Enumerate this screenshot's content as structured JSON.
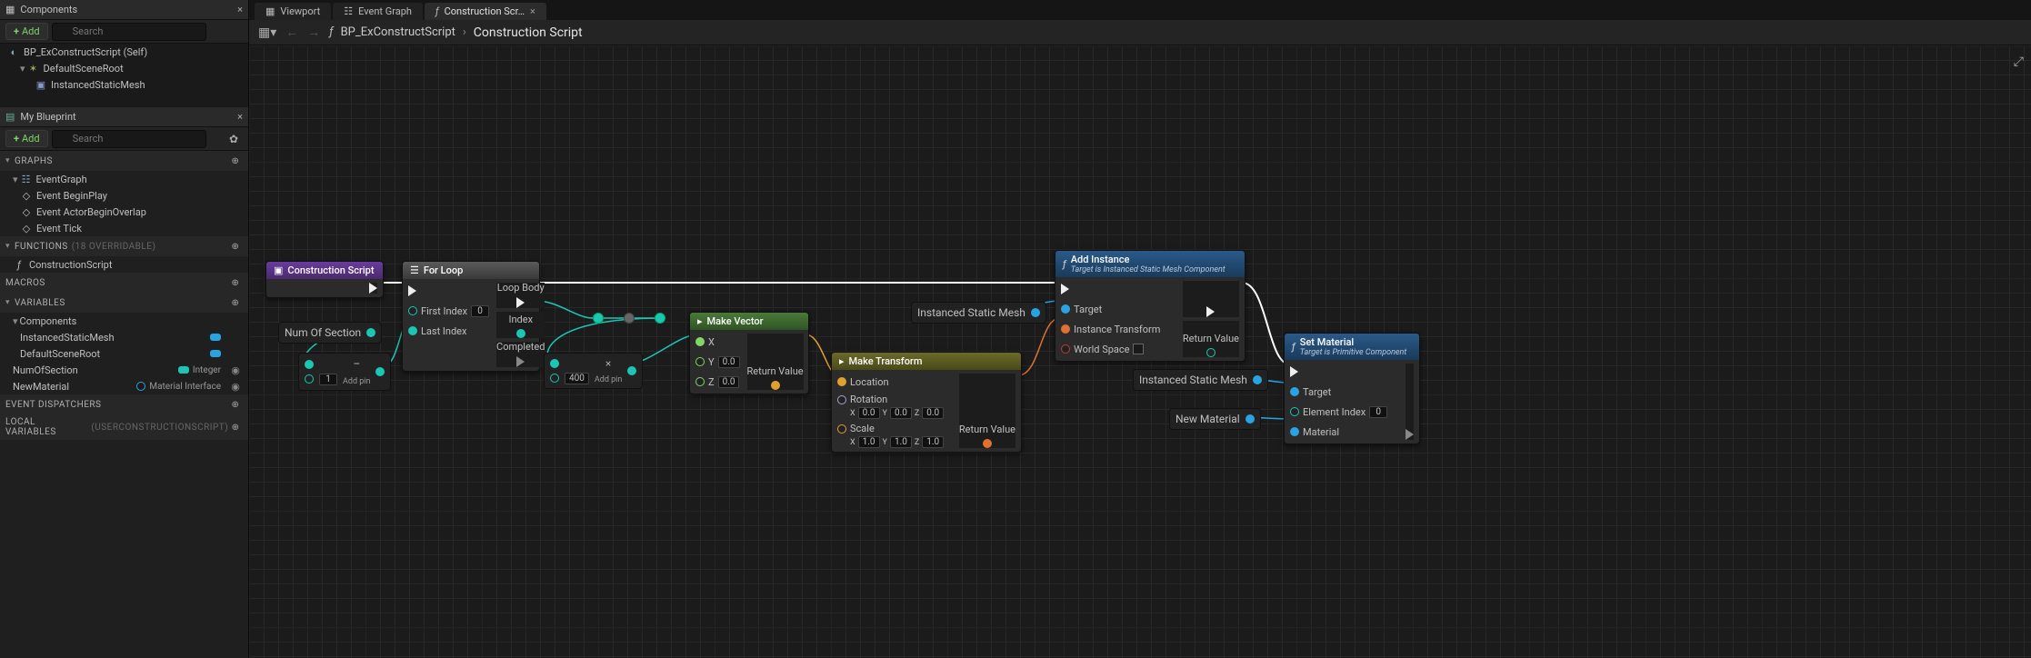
{
  "leftTabs": {
    "components": "Components",
    "myblueprint": "My Blueprint"
  },
  "addBtn": "Add",
  "searchPlaceholder": "Search",
  "componentsTree": {
    "root": "BP_ExConstructScript (Self)",
    "child1": "DefaultSceneRoot",
    "child2": "InstancedStaticMesh"
  },
  "mb": {
    "graphs": "GRAPHS",
    "eventGraph": "EventGraph",
    "evBeginPlay": "Event BeginPlay",
    "evActorOverlap": "Event ActorBeginOverlap",
    "evTick": "Event Tick",
    "functions": "FUNCTIONS",
    "functionsOverride": "(18 OVERRIDABLE)",
    "construction": "ConstructionScript",
    "macros": "MACROS",
    "variables": "VARIABLES",
    "varComponents": "Components",
    "varISM": "InstancedStaticMesh",
    "varDSR": "DefaultSceneRoot",
    "varNumSection": "NumOfSection",
    "varNumSectionType": "Integer",
    "varNewMat": "NewMaterial",
    "varNewMatType": "Material Interface",
    "eventDispatchers": "EVENT DISPATCHERS",
    "localVars": "LOCAL VARIABLES",
    "localVarsParen": "(USERCONSTRUCTIONSCRIPT)"
  },
  "topTabs": {
    "viewport": "Viewport",
    "eventGraph": "Event Graph",
    "construction": "Construction Scr…"
  },
  "breadcrumb": {
    "parent": "BP_ExConstructScript",
    "current": "Construction Script"
  },
  "nodes": {
    "cs": {
      "title": "Construction Script"
    },
    "forloop": {
      "title": "For Loop",
      "firstIndex": "First Index",
      "firstIndexVal": "0",
      "lastIndex": "Last Index",
      "loopBody": "Loop Body",
      "index": "Index",
      "completed": "Completed"
    },
    "numSectionVar": "Num Of Section",
    "subtract": {
      "val": "1",
      "addPin": "Add pin"
    },
    "multiply": {
      "val": "400",
      "addPin": "Add pin"
    },
    "makeVector": {
      "title": "Make Vector",
      "x": "X",
      "y": "Y",
      "z": "Z",
      "yv": "0.0",
      "zv": "0.0",
      "ret": "Return Value"
    },
    "makeTransform": {
      "title": "Make Transform",
      "location": "Location",
      "rotation": "Rotation",
      "scale": "Scale",
      "rx": "0.0",
      "ry": "0.0",
      "rz": "0.0",
      "sx": "1.0",
      "sy": "1.0",
      "sz": "1.0",
      "lblX": "X",
      "lblY": "Y",
      "lblZ": "Z",
      "ret": "Return Value"
    },
    "ism1": "Instanced Static Mesh",
    "ism2": "Instanced Static Mesh",
    "newMat": "New Material",
    "addInstance": {
      "title": "Add Instance",
      "sub": "Target is Instanced Static Mesh Component",
      "target": "Target",
      "instXform": "Instance Transform",
      "worldSpace": "World Space",
      "ret": "Return Value"
    },
    "setMaterial": {
      "title": "Set Material",
      "sub": "Target is Primitive Component",
      "target": "Target",
      "elemIdx": "Element Index",
      "elemIdxVal": "0",
      "material": "Material"
    }
  }
}
